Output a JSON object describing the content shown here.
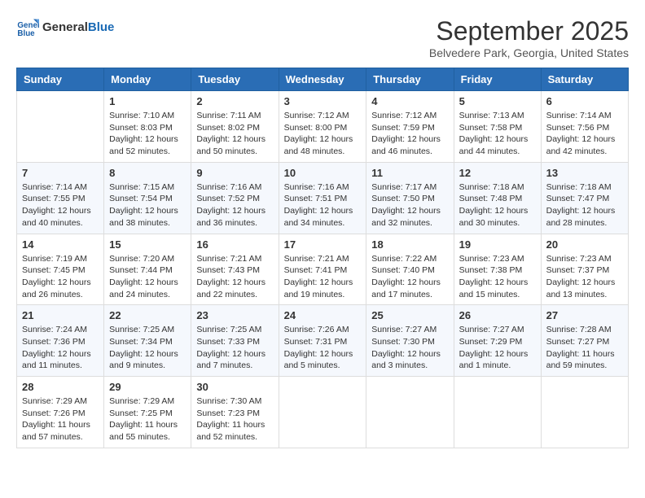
{
  "logo": {
    "text_general": "General",
    "text_blue": "Blue"
  },
  "title": "September 2025",
  "location": "Belvedere Park, Georgia, United States",
  "days_of_week": [
    "Sunday",
    "Monday",
    "Tuesday",
    "Wednesday",
    "Thursday",
    "Friday",
    "Saturday"
  ],
  "weeks": [
    [
      {
        "day": "",
        "info": ""
      },
      {
        "day": "1",
        "info": "Sunrise: 7:10 AM\nSunset: 8:03 PM\nDaylight: 12 hours\nand 52 minutes."
      },
      {
        "day": "2",
        "info": "Sunrise: 7:11 AM\nSunset: 8:02 PM\nDaylight: 12 hours\nand 50 minutes."
      },
      {
        "day": "3",
        "info": "Sunrise: 7:12 AM\nSunset: 8:00 PM\nDaylight: 12 hours\nand 48 minutes."
      },
      {
        "day": "4",
        "info": "Sunrise: 7:12 AM\nSunset: 7:59 PM\nDaylight: 12 hours\nand 46 minutes."
      },
      {
        "day": "5",
        "info": "Sunrise: 7:13 AM\nSunset: 7:58 PM\nDaylight: 12 hours\nand 44 minutes."
      },
      {
        "day": "6",
        "info": "Sunrise: 7:14 AM\nSunset: 7:56 PM\nDaylight: 12 hours\nand 42 minutes."
      }
    ],
    [
      {
        "day": "7",
        "info": "Sunrise: 7:14 AM\nSunset: 7:55 PM\nDaylight: 12 hours\nand 40 minutes."
      },
      {
        "day": "8",
        "info": "Sunrise: 7:15 AM\nSunset: 7:54 PM\nDaylight: 12 hours\nand 38 minutes."
      },
      {
        "day": "9",
        "info": "Sunrise: 7:16 AM\nSunset: 7:52 PM\nDaylight: 12 hours\nand 36 minutes."
      },
      {
        "day": "10",
        "info": "Sunrise: 7:16 AM\nSunset: 7:51 PM\nDaylight: 12 hours\nand 34 minutes."
      },
      {
        "day": "11",
        "info": "Sunrise: 7:17 AM\nSunset: 7:50 PM\nDaylight: 12 hours\nand 32 minutes."
      },
      {
        "day": "12",
        "info": "Sunrise: 7:18 AM\nSunset: 7:48 PM\nDaylight: 12 hours\nand 30 minutes."
      },
      {
        "day": "13",
        "info": "Sunrise: 7:18 AM\nSunset: 7:47 PM\nDaylight: 12 hours\nand 28 minutes."
      }
    ],
    [
      {
        "day": "14",
        "info": "Sunrise: 7:19 AM\nSunset: 7:45 PM\nDaylight: 12 hours\nand 26 minutes."
      },
      {
        "day": "15",
        "info": "Sunrise: 7:20 AM\nSunset: 7:44 PM\nDaylight: 12 hours\nand 24 minutes."
      },
      {
        "day": "16",
        "info": "Sunrise: 7:21 AM\nSunset: 7:43 PM\nDaylight: 12 hours\nand 22 minutes."
      },
      {
        "day": "17",
        "info": "Sunrise: 7:21 AM\nSunset: 7:41 PM\nDaylight: 12 hours\nand 19 minutes."
      },
      {
        "day": "18",
        "info": "Sunrise: 7:22 AM\nSunset: 7:40 PM\nDaylight: 12 hours\nand 17 minutes."
      },
      {
        "day": "19",
        "info": "Sunrise: 7:23 AM\nSunset: 7:38 PM\nDaylight: 12 hours\nand 15 minutes."
      },
      {
        "day": "20",
        "info": "Sunrise: 7:23 AM\nSunset: 7:37 PM\nDaylight: 12 hours\nand 13 minutes."
      }
    ],
    [
      {
        "day": "21",
        "info": "Sunrise: 7:24 AM\nSunset: 7:36 PM\nDaylight: 12 hours\nand 11 minutes."
      },
      {
        "day": "22",
        "info": "Sunrise: 7:25 AM\nSunset: 7:34 PM\nDaylight: 12 hours\nand 9 minutes."
      },
      {
        "day": "23",
        "info": "Sunrise: 7:25 AM\nSunset: 7:33 PM\nDaylight: 12 hours\nand 7 minutes."
      },
      {
        "day": "24",
        "info": "Sunrise: 7:26 AM\nSunset: 7:31 PM\nDaylight: 12 hours\nand 5 minutes."
      },
      {
        "day": "25",
        "info": "Sunrise: 7:27 AM\nSunset: 7:30 PM\nDaylight: 12 hours\nand 3 minutes."
      },
      {
        "day": "26",
        "info": "Sunrise: 7:27 AM\nSunset: 7:29 PM\nDaylight: 12 hours\nand 1 minute."
      },
      {
        "day": "27",
        "info": "Sunrise: 7:28 AM\nSunset: 7:27 PM\nDaylight: 11 hours\nand 59 minutes."
      }
    ],
    [
      {
        "day": "28",
        "info": "Sunrise: 7:29 AM\nSunset: 7:26 PM\nDaylight: 11 hours\nand 57 minutes."
      },
      {
        "day": "29",
        "info": "Sunrise: 7:29 AM\nSunset: 7:25 PM\nDaylight: 11 hours\nand 55 minutes."
      },
      {
        "day": "30",
        "info": "Sunrise: 7:30 AM\nSunset: 7:23 PM\nDaylight: 11 hours\nand 52 minutes."
      },
      {
        "day": "",
        "info": ""
      },
      {
        "day": "",
        "info": ""
      },
      {
        "day": "",
        "info": ""
      },
      {
        "day": "",
        "info": ""
      }
    ]
  ]
}
